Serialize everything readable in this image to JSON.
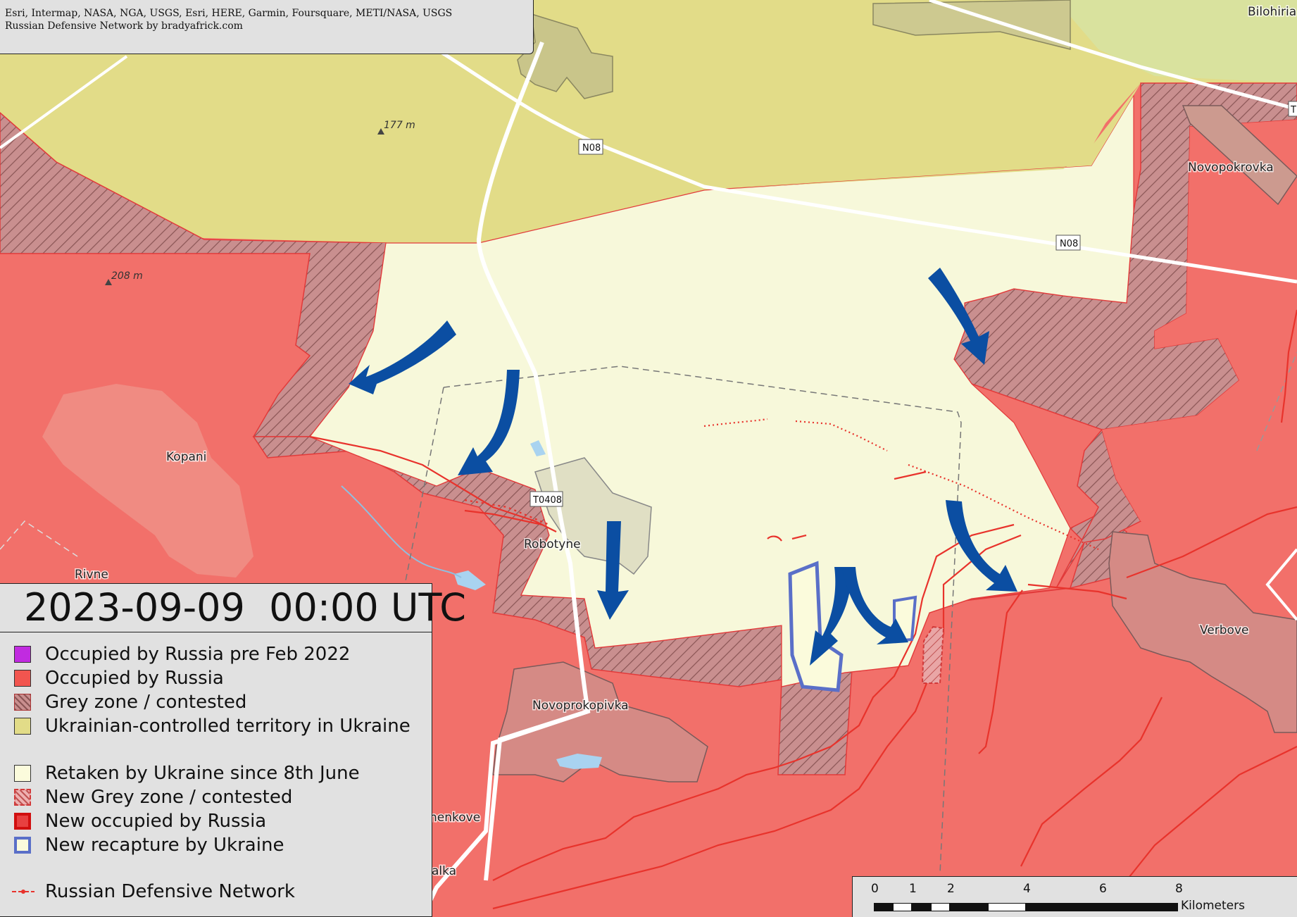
{
  "attribution": {
    "line1": "Esri, Intermap, NASA, NGA, USGS, Esri, HERE, Garmin, Foursquare, METI/NASA, USGS",
    "line2": "Russian Defensive Network by bradyafrick.com"
  },
  "timestamp": "2023-09-09  00:00 UTC",
  "legend": {
    "items": [
      {
        "label": "Occupied by Russia pre Feb 2022",
        "color": "#c12be0"
      },
      {
        "label": "Occupied by Russia",
        "color": "#f2554f"
      },
      {
        "label": "Grey zone / contested",
        "color": "#c98f8f"
      },
      {
        "label": "Ukrainian-controlled territory in Ukraine",
        "color": "#e2dc88"
      },
      {
        "label": "Retaken by Ukraine since 8th June",
        "color": "#fbfbdc"
      },
      {
        "label": "New Grey zone / contested",
        "color": "#e23a3a"
      },
      {
        "label": "New occupied by Russia",
        "color": "#e81818"
      },
      {
        "label": "New recapture by Ukraine",
        "color": "#5a6fc8"
      },
      {
        "label": "Russian Defensive Network",
        "color": "#e8332c"
      }
    ]
  },
  "places": {
    "bilohiria": "Bilohiria",
    "novopokrovka": "Novopokrovka",
    "kopani": "Kopani",
    "robotyne": "Robotyne",
    "rivne": "Rivne",
    "verbove": "Verbove",
    "novoprokopivka": "Novoprokopivka",
    "menkove": "nenkove",
    "malka": "alka"
  },
  "elevations": {
    "e177": "177 m",
    "e208": "208 m"
  },
  "roads": {
    "n08_a": "N08",
    "n08_b": "N08",
    "t0408": "T0408",
    "edge": "T"
  },
  "scale": {
    "ticks": [
      "0",
      "1",
      "2",
      "4",
      "6",
      "8"
    ],
    "unit": "Kilometers"
  },
  "colors": {
    "russia": "#f2706a",
    "ukraine": "#e2dc88",
    "retaken": "#f7f8da",
    "arrow": "#0b4ea2"
  }
}
